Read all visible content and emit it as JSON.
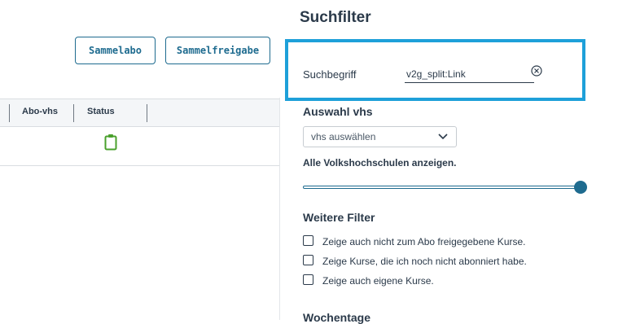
{
  "buttons": {
    "sammelabo": "Sammelabo",
    "sammelfreigabe": "Sammelfreigabe"
  },
  "table": {
    "columns": [
      "Abo-vhs",
      "Status"
    ]
  },
  "filter_panel": {
    "title": "Suchfilter",
    "search": {
      "label": "Suchbegriff",
      "value": "v2g_split:Link"
    },
    "vhs_section": {
      "heading": "Auswahl vhs",
      "select_value": "vhs auswählen",
      "all_label": "Alle Volkshochschulen anzeigen."
    },
    "slider": {
      "level": 1.0
    },
    "further_filters": {
      "heading": "Weitere Filter",
      "options": [
        {
          "label": "Zeige auch nicht zum Abo freigegebene Kurse.",
          "checked": false
        },
        {
          "label": "Zeige Kurse, die ich noch nicht abonniert habe.",
          "checked": false
        },
        {
          "label": "Zeige auch eigene Kurse.",
          "checked": false
        }
      ]
    },
    "weekdays_heading": "Wochentage"
  },
  "icons": {
    "status": "clipboard-icon",
    "clear": "clear-circle-icon",
    "select": "chevron-down-icon"
  },
  "colors": {
    "accent": "#1e6b8f",
    "highlight": "#1ea0d9",
    "status_green": "#4aa02c"
  }
}
